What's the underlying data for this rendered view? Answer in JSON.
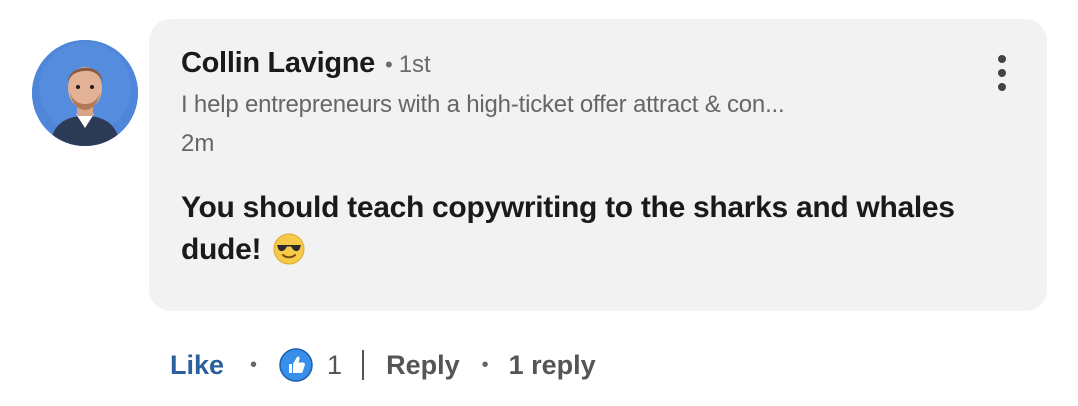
{
  "comment": {
    "author_name": "Collin Lavigne",
    "degree_separator": "•",
    "connection_degree": "1st",
    "headline": "I help entrepreneurs with a high-ticket offer attract & con...",
    "timestamp": "2m",
    "text": "You should teach copywriting to the sharks and whales dude!",
    "emoji_icon": "smiling-face-with-sunglasses-icon",
    "more_icon": "more-vertical-icon"
  },
  "actions": {
    "like_label": "Like",
    "dot": "•",
    "reaction_icon": "like-reaction-icon",
    "reaction_count": "1",
    "reply_label": "Reply",
    "reply_count_label": "1 reply"
  },
  "colors": {
    "bubble_bg": "#f2f2f2",
    "like_blue": "#2d5f9e",
    "reaction_blue": "#378fe9",
    "avatar_bg": "#4f86d9"
  }
}
